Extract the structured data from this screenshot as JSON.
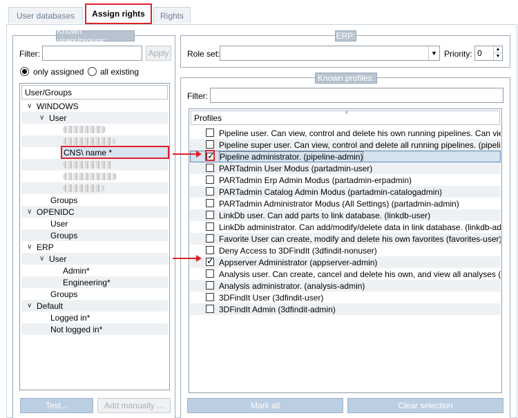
{
  "tabs": [
    {
      "label": "User databases"
    },
    {
      "label": "Assign rights"
    },
    {
      "label": "Rights"
    }
  ],
  "left": {
    "group_title": "Known users/groups:",
    "filter_label": "Filter:",
    "filter_value": "",
    "apply_label": "Apply",
    "radio_only_assigned": "only assigned",
    "radio_all_existing": "all existing",
    "tree_header": "User/Groups",
    "tree": {
      "windows": "WINDOWS",
      "user": "User",
      "selected_user": "CNS\\  name   *",
      "groups": "Groups",
      "openidc": "OPENIDC",
      "openidc_user": "User",
      "openidc_groups": "Groups",
      "erp": "ERP",
      "erp_user": "User",
      "admin": "Admin*",
      "engineering": "Engineering*",
      "erp_groups": "Groups",
      "default": "Default",
      "logged_in": "Logged in*",
      "not_logged_in": "Not logged in*"
    },
    "test_label": "Test...",
    "add_manually_label": "Add manually ..."
  },
  "right": {
    "erp_title": "ERP:",
    "role_set_label": "Role set:",
    "role_set_value": "",
    "priority_label": "Priority:",
    "priority_value": "0",
    "profiles_title": "Known profiles:",
    "filter_label": "Filter:",
    "filter_value": "",
    "profiles_header": "Profiles",
    "profiles": [
      {
        "label": "Pipeline user. Can view, control and delete his own running pipelines. Can view ...",
        "checked": false
      },
      {
        "label": "Pipeline super user. Can view, control and delete all running pipelines. (pipeline-...",
        "checked": false
      },
      {
        "label": "Pipeline administrator. (pipeline-admin)",
        "checked": true
      },
      {
        "label": "PARTadmin User Modus (partadmin-user)",
        "checked": false
      },
      {
        "label": "PARTadmin Erp Admin Modus (partadmin-erpadmin)",
        "checked": false
      },
      {
        "label": "PARTadmin Catalog Admin Modus (partadmin-catalogadmin)",
        "checked": false
      },
      {
        "label": "PARTadmin Administrator Modus (All Settings) (partadmin-admin)",
        "checked": false
      },
      {
        "label": "LinkDb user. Can add parts to link database. (linkdb-user)",
        "checked": false
      },
      {
        "label": "LinkDb administrator. Can add/modify/delete data in link database. (linkdb-ad...",
        "checked": false
      },
      {
        "label": "Favorite User can create, modify and delete his own favorites (favorites-user)",
        "checked": false
      },
      {
        "label": "Deny Access to 3DFindIt (3dfindit-nonuser)",
        "checked": false
      },
      {
        "label": "Appserver Administrator (appserver-admin)",
        "checked": true
      },
      {
        "label": "Analysis user. Can create, cancel and delete his own, and view all analyses (analy...",
        "checked": false
      },
      {
        "label": "Analysis administrator. (analysis-admin)",
        "checked": false
      },
      {
        "label": "3DFindIt User (3dfindit-user)",
        "checked": false
      },
      {
        "label": "3DFindIt Admin (3dfindit-admin)",
        "checked": false
      }
    ],
    "mark_all_label": "Mark all",
    "clear_selection_label": "Clear selection"
  },
  "colors": {
    "highlight_red": "#e0202a",
    "button_blue": "#bccee2",
    "group_title_bg": "#b7c3cf"
  }
}
